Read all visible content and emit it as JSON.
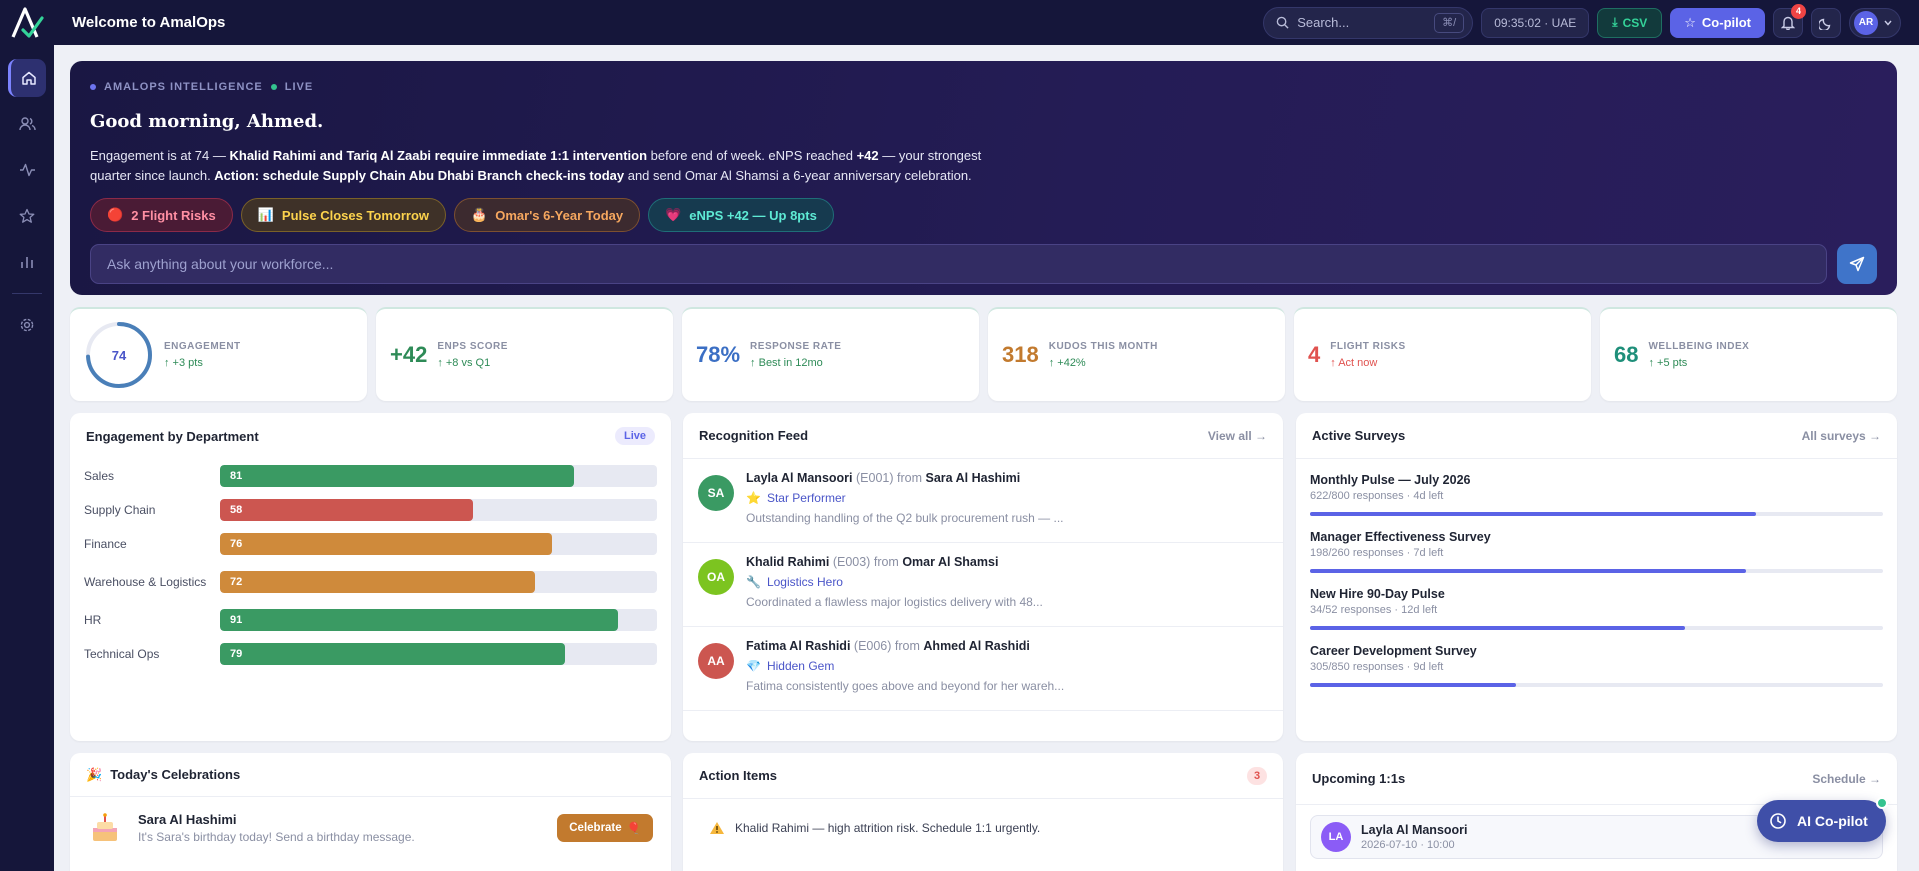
{
  "header": {
    "title": "Welcome to AmalOps",
    "search_placeholder": "Search...",
    "search_shortcut": "⌘/",
    "clock": "09:35:02 · UAE",
    "csv_label": "CSV",
    "copilot_label": "Co-pilot",
    "notification_count": "4",
    "user_initials": "AR"
  },
  "hero": {
    "eyebrow": "AMALOPS INTELLIGENCE",
    "live": "LIVE",
    "greeting": "Good morning, Ahmed.",
    "text_1": "Engagement is at 74 — ",
    "text_2": "Khalid Rahimi and Tariq Al Zaabi require immediate 1:1 intervention",
    "text_3": " before end of week. eNPS reached ",
    "text_4": "+42",
    "text_5": " — your strongest quarter since launch. ",
    "text_6": "Action: schedule Supply Chain Abu Dhabi Branch check-ins today",
    "text_7": " and send Omar Al Shamsi a 6-year anniversary celebration.",
    "chips": [
      {
        "icon": "🔴",
        "label": "2 Flight Risks"
      },
      {
        "icon": "📊",
        "label": "Pulse Closes Tomorrow"
      },
      {
        "icon": "🎂",
        "label": "Omar's 6-Year Today"
      },
      {
        "icon": "💗",
        "label": "eNPS +42 — Up 8pts"
      }
    ],
    "ask_placeholder": "Ask anything about your workforce..."
  },
  "kpis": [
    {
      "value": "74",
      "label": "ENGAGEMENT",
      "delta": "↑ +3 pts",
      "color": "#4a55c8",
      "progress": 0.74
    },
    {
      "value": "+42",
      "label": "ENPS SCORE",
      "delta": "↑ +8 vs Q1",
      "color": "#2e8b57"
    },
    {
      "value": "78%",
      "label": "RESPONSE RATE",
      "delta": "↑ Best in 12mo",
      "color": "#3b6fc4"
    },
    {
      "value": "318",
      "label": "KUDOS THIS MONTH",
      "delta": "↑ +42%",
      "color": "#c27a2e"
    },
    {
      "value": "4",
      "label": "FLIGHT RISKS",
      "delta": "↑ Act now",
      "color": "#e0524f"
    },
    {
      "value": "68",
      "label": "WELLBEING INDEX",
      "delta": "↑ +5 pts",
      "color": "#1f8f7a"
    }
  ],
  "departments": {
    "title": "Engagement by Department",
    "badge": "Live",
    "rows": [
      {
        "name": "Sales",
        "value": 81,
        "color": "#3a9a63"
      },
      {
        "name": "Supply Chain",
        "value": 58,
        "color": "#cc5650"
      },
      {
        "name": "Finance",
        "value": 76,
        "color": "#cf8a3b"
      },
      {
        "name": "Warehouse & Logistics",
        "value": 72,
        "color": "#cf8a3b"
      },
      {
        "name": "HR",
        "value": 91,
        "color": "#3a9a63"
      },
      {
        "name": "Technical Ops",
        "value": 79,
        "color": "#3a9a63"
      }
    ]
  },
  "recognition": {
    "title": "Recognition Feed",
    "link": "View all →",
    "from_word": "from",
    "items": [
      {
        "initials": "SA",
        "avatar_color": "#3a9a63",
        "to": "Layla Al Mansoori",
        "id": "(E001)",
        "from": "Sara Al Hashimi",
        "badge_icon": "⭐",
        "badge": "Star Performer",
        "message": "Outstanding handling of the Q2 bulk procurement rush — ..."
      },
      {
        "initials": "OA",
        "avatar_color": "#7cc420",
        "to": "Khalid Rahimi",
        "id": "(E003)",
        "from": "Omar Al Shamsi",
        "badge_icon": "🔧",
        "badge": "Logistics Hero",
        "message": "Coordinated a flawless major logistics delivery with 48..."
      },
      {
        "initials": "AA",
        "avatar_color": "#cc5650",
        "to": "Fatima Al Rashidi",
        "id": "(E006)",
        "from": "Ahmed Al Rashidi",
        "badge_icon": "💎",
        "badge": "Hidden Gem",
        "message": "Fatima consistently goes above and beyond for her wareh..."
      }
    ]
  },
  "surveys": {
    "title": "Active Surveys",
    "link": "All surveys →",
    "items": [
      {
        "name": "Monthly Pulse — July 2026",
        "meta": "622/800 responses · 4d left",
        "progress": 0.7775
      },
      {
        "name": "Manager Effectiveness Survey",
        "meta": "198/260 responses · 7d left",
        "progress": 0.7615
      },
      {
        "name": "New Hire 90-Day Pulse",
        "meta": "34/52 responses · 12d left",
        "progress": 0.6538
      },
      {
        "name": "Career Development Survey",
        "meta": "305/850 responses · 9d left",
        "progress": 0.3588
      }
    ]
  },
  "celebrations": {
    "title": "Today's Celebrations",
    "title_icon": "🎉",
    "name": "Sara Al Hashimi",
    "message": "It's Sara's birthday today! Send a birthday message.",
    "button": "Celebrate",
    "button_icon": "🎈"
  },
  "actions": {
    "title": "Action Items",
    "count": "3",
    "first": "Khalid Rahimi — high attrition risk. Schedule 1:1 urgently."
  },
  "oneones": {
    "title": "Upcoming 1:1s",
    "link": "Schedule →",
    "initials": "LA",
    "name": "Layla Al Mansoori",
    "date": "2026-07-10 · 10:00"
  },
  "fab": {
    "label": "AI Co-pilot"
  }
}
